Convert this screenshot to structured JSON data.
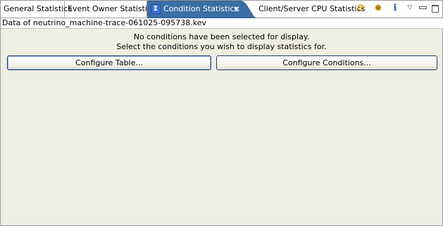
{
  "tabs": [
    {
      "label": "General Statistics",
      "active": false
    },
    {
      "label": "Event Owner Statistics",
      "active": false
    },
    {
      "label": "Condition Statistics",
      "active": true
    },
    {
      "label": "Client/Server CPU Statistics",
      "active": false
    }
  ],
  "toolbar": {
    "icons": [
      "sync-icon",
      "gear-icon",
      "info-icon",
      "view-menu-icon",
      "minimize-icon",
      "maximize-icon"
    ],
    "info_glyph": "i",
    "sigma_glyph": "Σ",
    "close_glyph": "✕"
  },
  "file": {
    "label": "Data of neutrino_machine-trace-061025-095738.kev"
  },
  "message": {
    "line1": "No conditions have been selected for display.",
    "line2": "Select the conditions you wish to display statistics for."
  },
  "buttons": {
    "configure_table": "Configure Table...",
    "configure_conditions": "Configure Conditions..."
  },
  "colors": {
    "active_tab": "#3b6ea5",
    "background": "#ece9d8",
    "button_border": "#1d3c6e"
  }
}
